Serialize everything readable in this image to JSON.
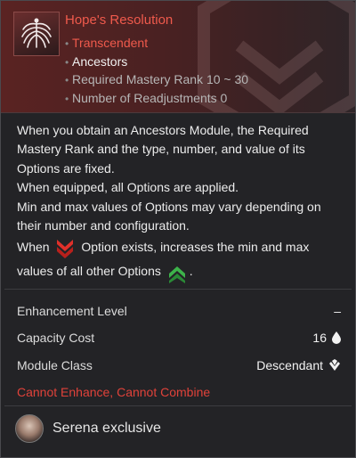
{
  "module": {
    "name": "Hope's Resolution",
    "rarity": "Transcendent",
    "category": "Ancestors",
    "mastery_rank": "Required Mastery Rank 10 ~ 30",
    "readjustments": "Number of Readjustments 0"
  },
  "description": {
    "para1": "When you obtain an Ancestors Module, the Required Mastery Rank and the type, number, and value of its Options are fixed.",
    "para2": "When equipped, all Options are applied.",
    "para3": "Min and max values of Options may vary depending on their number and configuration.",
    "rule_prefix": "When",
    "rule_middle": "Option exists, increases the min and max",
    "rule_suffix": "values of all other Options",
    "rule_end": "."
  },
  "stats": {
    "enhancement_label": "Enhancement Level",
    "enhancement_value": "–",
    "capacity_label": "Capacity Cost",
    "capacity_value": "16",
    "class_label": "Module Class",
    "class_value": "Descendant"
  },
  "restriction": "Cannot Enhance, Cannot Combine",
  "exclusive": "Serena exclusive",
  "colors": {
    "rarity": "#ef5a4c",
    "restriction": "#e0423a",
    "negative_chevron": "#e0302a",
    "positive_chevron": "#3db34a"
  },
  "icons": {
    "module": "winged-emblem-icon",
    "negative": "double-chevron-down-icon",
    "positive": "double-chevron-up-icon",
    "capacity": "droplet-icon",
    "class": "descendant-class-icon"
  }
}
